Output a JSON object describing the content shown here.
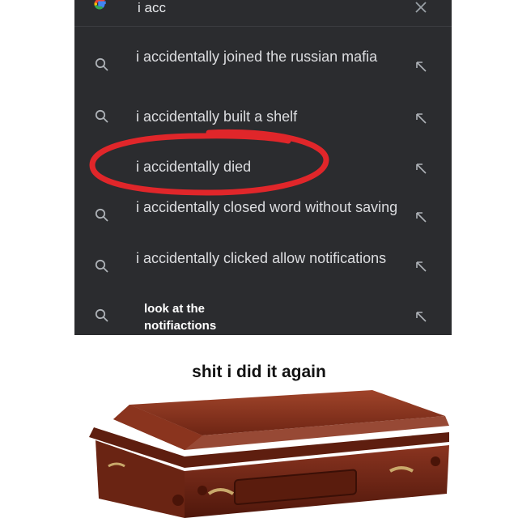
{
  "search": {
    "query": "i acc",
    "suggestions": [
      {
        "text": "i accidentally joined the russian mafia"
      },
      {
        "text": "i accidentally built a shelf"
      },
      {
        "text": "i accidentally died"
      },
      {
        "text": "i accidentally closed word without saving"
      },
      {
        "text": "i accidentally clicked allow notifications"
      },
      {
        "text": "look at the notifiactions"
      }
    ]
  },
  "meme": {
    "caption": "shit i did it again"
  },
  "colors": {
    "panel_bg": "#2b2c2f",
    "suggestion_text": "#dcdde0",
    "circle_red": "#e0262a",
    "coffin_wood": "#7a2a17"
  },
  "icons": {
    "logo": "google-logo-icon",
    "close": "close-icon",
    "search": "search-icon",
    "fill_query": "arrow-up-left-icon"
  }
}
